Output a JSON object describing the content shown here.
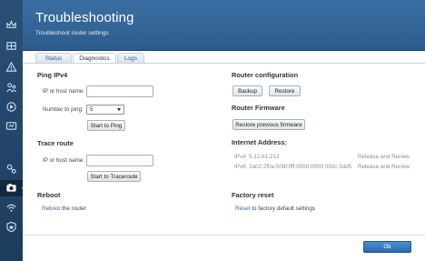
{
  "header": {
    "title": "Troubleshooting",
    "subtitle": "Troubleshoot router settings"
  },
  "tabs": [
    {
      "label": "Status",
      "active": false
    },
    {
      "label": "Diagnostics",
      "active": true
    },
    {
      "label": "Logs",
      "active": false
    }
  ],
  "sidebar": {
    "icons": [
      "crown-icon",
      "network-map-icon",
      "alert-icon",
      "parental-icon",
      "media-prioritization-icon",
      "speed-test-icon",
      "connectivity-icon",
      "troubleshooting-icon",
      "wireless-icon",
      "security-icon"
    ],
    "active": "troubleshooting-icon"
  },
  "ping": {
    "title": "Ping IPv4",
    "host_label": "IP or host name:",
    "host_value": "",
    "number_label": "Number to ping:",
    "number_value": "5",
    "start_label": "Start to Ping"
  },
  "traceroute": {
    "title": "Trace route",
    "host_label": "IP or host name:",
    "host_value": "",
    "start_label": "Start to Traceroute"
  },
  "reboot": {
    "title": "Reboot",
    "link_label": "Reboot",
    "suffix": "the router"
  },
  "router_config": {
    "title": "Router configuration",
    "backup_label": "Backup",
    "restore_label": "Restore"
  },
  "router_firmware": {
    "title": "Router Firmware",
    "restore_prev_label": "Restore previous firmware"
  },
  "internet_address": {
    "title": "Internet Address:",
    "ipv4_label": "IPv4: 5.12.61.213",
    "ipv6_label": "IPv6: 2a02:2f0a:508f:ffff:0000:0000:050c:3dd5",
    "release_renew_ipv4": "Release and Renew",
    "release_renew_ipv6": "Release and Renew"
  },
  "factory_reset": {
    "title": "Factory reset",
    "link_label": "Reset",
    "suffix": "to factory default settings"
  },
  "footer": {
    "ok_label": "Ok"
  },
  "colors": {
    "header_bg": "#3b6fa3",
    "sidebar_bg": "#2a4f76",
    "link": "#2e6aa3",
    "ok_button": "#2a6cae"
  }
}
